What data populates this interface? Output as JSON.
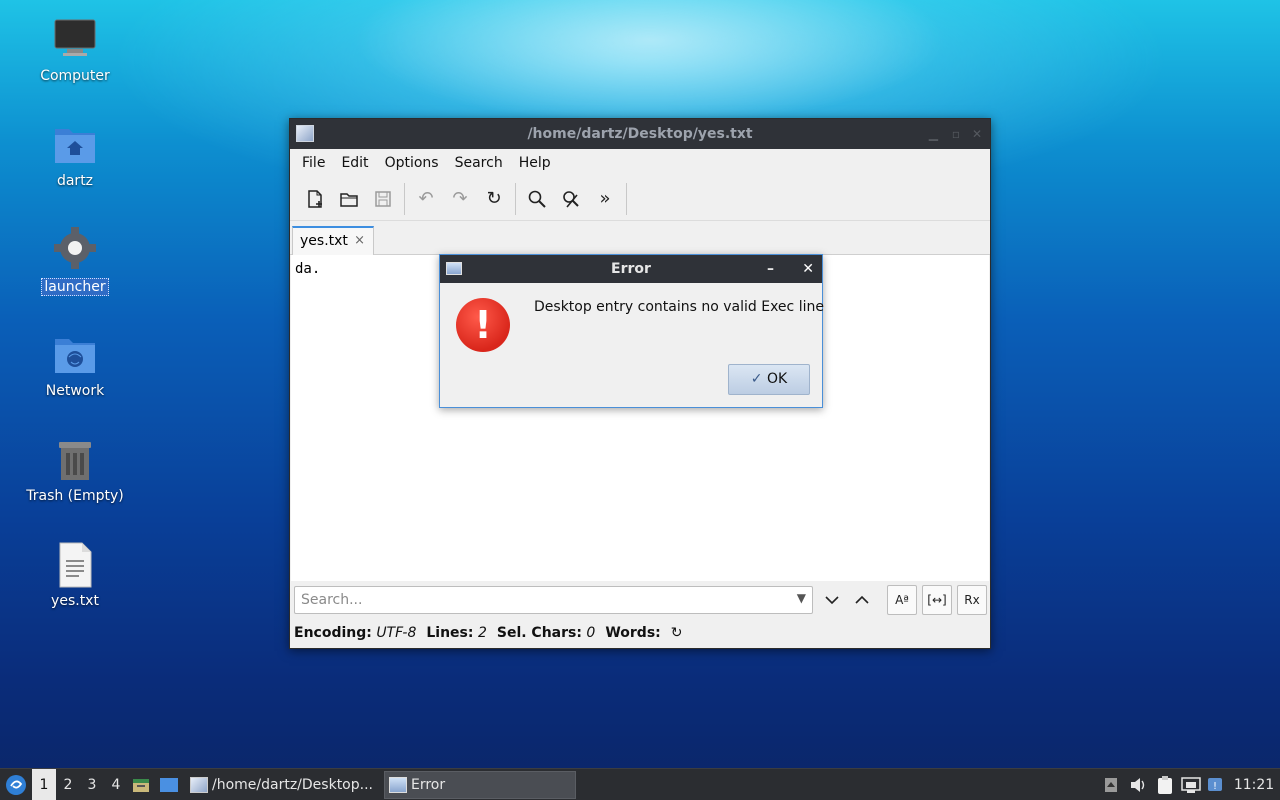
{
  "desktop": {
    "icons": [
      {
        "label": "Computer",
        "icon": "monitor-icon"
      },
      {
        "label": "dartz",
        "icon": "home-folder-icon"
      },
      {
        "label": "launcher",
        "icon": "gear-icon"
      },
      {
        "label": "Network",
        "icon": "network-folder-icon"
      },
      {
        "label": "Trash (Empty)",
        "icon": "trash-icon"
      },
      {
        "label": "yes.txt",
        "icon": "text-file-icon"
      }
    ]
  },
  "editor": {
    "title": "/home/dartz/Desktop/yes.txt",
    "menu": [
      "File",
      "Edit",
      "Options",
      "Search",
      "Help"
    ],
    "tab_label": "yes.txt",
    "tab_close": "×",
    "content": "da.",
    "search_placeholder": "Search...",
    "status": {
      "encoding_label": "Encoding:",
      "encoding_value": "UTF-8",
      "lines_label": "Lines:",
      "lines_value": "2",
      "sel_label": "Sel. Chars:",
      "sel_value": "0",
      "words_label": "Words:"
    }
  },
  "dialog": {
    "title": "Error",
    "message": "Desktop entry contains no valid Exec line",
    "ok_label": "OK",
    "minimize": "–",
    "close": "✕"
  },
  "taskbar": {
    "workspaces": [
      "1",
      "2",
      "3",
      "4"
    ],
    "tasks": [
      "/home/dartz/Desktop...",
      "Error"
    ],
    "clock": "11:21"
  },
  "colors": {
    "titlebar": "#2f3238",
    "dialog_border": "#4a8fd8",
    "error_red": "#d9261b",
    "taskbar": "#2b2d31"
  }
}
